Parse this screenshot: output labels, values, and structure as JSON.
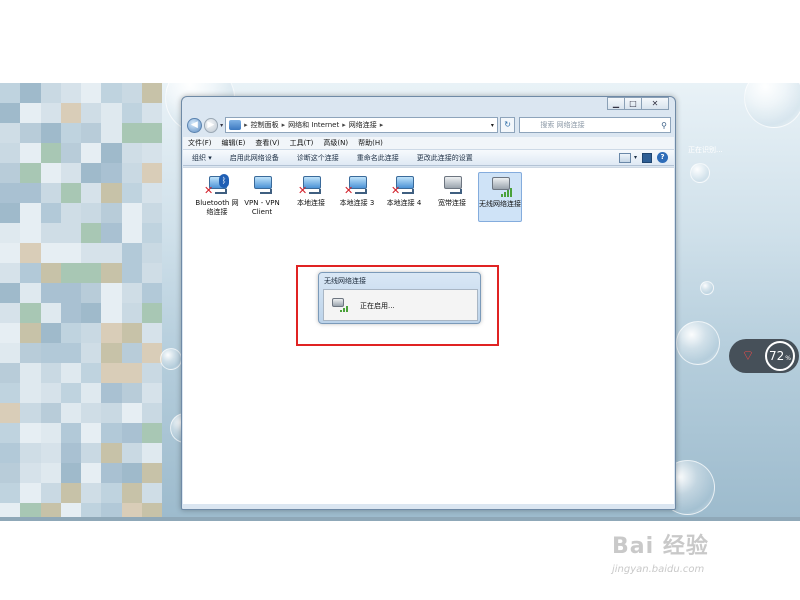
{
  "desktop": {
    "side_text": "正在识别...",
    "widget": {
      "value": "72",
      "unit": "%"
    }
  },
  "window": {
    "controls": {
      "minimize": "▁",
      "maximize": "□",
      "close": "✕"
    },
    "nav": {
      "back": "◀",
      "forward": "▶",
      "dropdown": "▾"
    },
    "breadcrumb": [
      "控制面板",
      "网络和 Internet",
      "网络连接"
    ],
    "refresh": "↻",
    "search_placeholder": "搜索 网络连接",
    "menu": [
      "文件(F)",
      "编辑(E)",
      "查看(V)",
      "工具(T)",
      "高级(N)",
      "帮助(H)"
    ],
    "toolbar": [
      "组织 ▾",
      "启用此网络设备",
      "诊断这个连接",
      "重命名此连接",
      "更改此连接的设置"
    ],
    "help": "?",
    "connections": [
      {
        "name": "Bluetooth 网络连接",
        "icon": "bluetooth-icon",
        "disabled": true
      },
      {
        "name": "VPN - VPN Client",
        "icon": "vpn-icon",
        "disabled": false
      },
      {
        "name": "本地连接",
        "icon": "lan-icon",
        "disabled": true
      },
      {
        "name": "本地连接 3",
        "icon": "lan-icon",
        "disabled": true
      },
      {
        "name": "本地连接 4",
        "icon": "lan-icon",
        "disabled": true
      },
      {
        "name": "宽带连接",
        "icon": "broadband-icon",
        "disabled": false
      },
      {
        "name": "无线网络连接",
        "icon": "wireless-icon",
        "disabled": false,
        "selected": true
      }
    ]
  },
  "dialog": {
    "title": "无线网络连接",
    "message": "正在启用..."
  },
  "watermark": {
    "line1": "Bai 经验",
    "line2": "jingyan.baidu.com"
  }
}
